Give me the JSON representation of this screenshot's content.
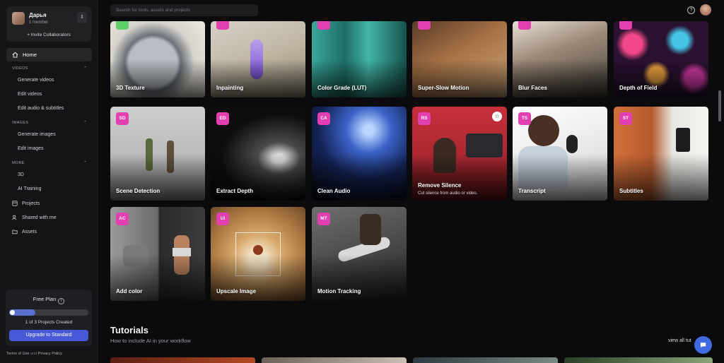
{
  "workspace": {
    "name": "Дарья",
    "members": "1 member",
    "invite": "+ Invite Collaborators"
  },
  "nav": {
    "home": "Home",
    "sections": [
      {
        "label": "VIDEOS",
        "items": [
          "Generate videos",
          "Edit videos",
          "Edit audio & subtitles"
        ]
      },
      {
        "label": "IMAGES",
        "items": [
          "Generate images",
          "Edit images"
        ]
      },
      {
        "label": "MORE",
        "items": [
          "3D",
          "AI Training"
        ]
      }
    ],
    "projects": "Projects",
    "shared": "Shared with me",
    "assets": "Assets"
  },
  "plan": {
    "title": "Free Plan",
    "count": "1 of 3 Projects Created",
    "progress": 0.33,
    "upgrade": "Upgrade to Standard"
  },
  "footer": {
    "terms": "Terms of Use",
    "and": "and",
    "privacy": "Privacy Policy"
  },
  "search": {
    "placeholder": "Search for tools, assets and projects"
  },
  "tools_row1": [
    {
      "title": "3D Texture"
    },
    {
      "title": "Inpainting"
    },
    {
      "title": "Color Grade (LUT)"
    },
    {
      "title": "Super-Slow Motion"
    },
    {
      "title": "Blur Faces"
    },
    {
      "title": "Depth of Field"
    }
  ],
  "tools_row2": [
    {
      "badge": "SD",
      "title": "Scene Detection"
    },
    {
      "badge": "ED",
      "title": "Extract Depth"
    },
    {
      "badge": "CA",
      "title": "Clean Audio"
    },
    {
      "badge": "RS",
      "title": "Remove Silence",
      "desc": "Cut silence from audio or video."
    },
    {
      "badge": "TS",
      "title": "Transcript"
    },
    {
      "badge": "ST",
      "title": "Subtitles"
    }
  ],
  "tools_row3": [
    {
      "badge": "AC",
      "title": "Add color"
    },
    {
      "badge": "UI",
      "title": "Upscale Image"
    },
    {
      "badge": "MT",
      "title": "Motion Tracking"
    }
  ],
  "tutorials": {
    "title": "Tutorials",
    "subtitle": "How to include AI in your workflow",
    "view_all": "view all tut"
  },
  "colors": {
    "accent": "#4859d8",
    "badge": "#e23fb0",
    "chat": "#3f6ae0"
  }
}
